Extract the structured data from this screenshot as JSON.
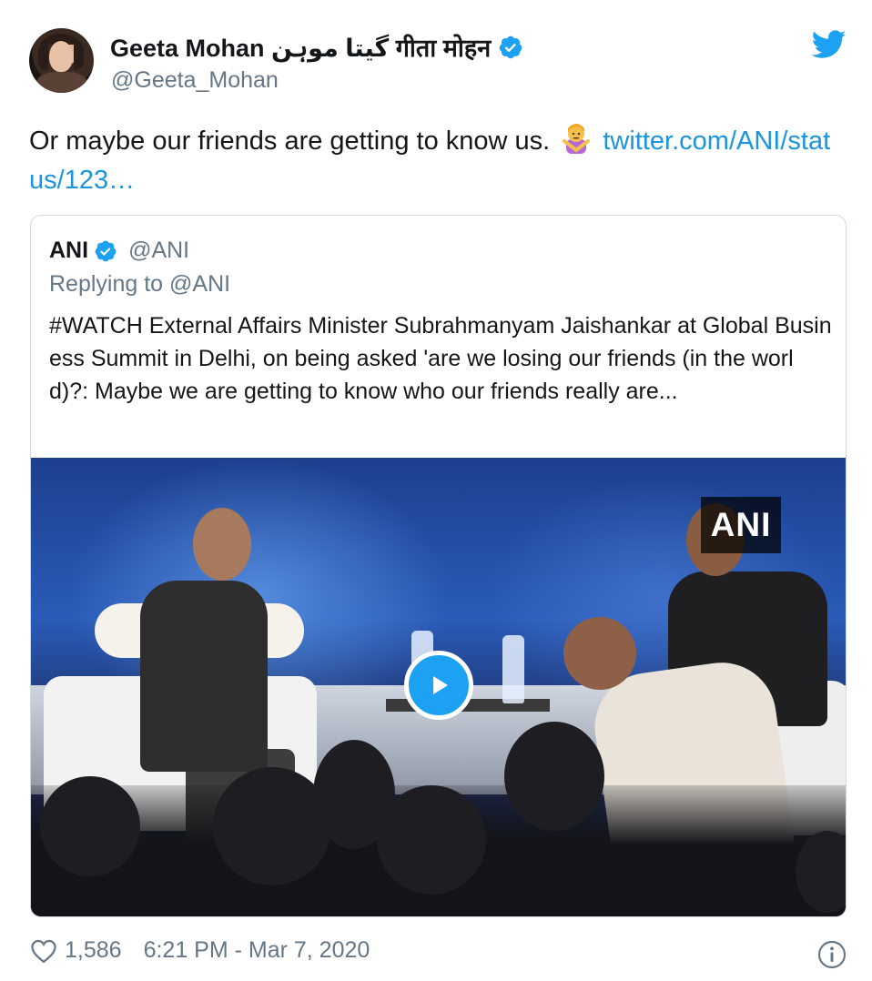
{
  "author": {
    "display_name": "Geeta Mohan گیتا موہن गीता मोहन",
    "handle": "@Geeta_Mohan",
    "verified": true
  },
  "tweet": {
    "text": "Or maybe our friends are getting to know us.",
    "emoji": "person-gesturing-no-emoji",
    "link": "twitter.com/ANI/status/123…"
  },
  "quoted_tweet": {
    "name": "ANI",
    "handle": "@ANI",
    "verified": true,
    "replying_to": "Replying to @ANI",
    "text": "#WATCH External Affairs Minister Subrahmanyam Jaishankar at Global Business Summit in Delhi, on being asked 'are we losing our friends (in the world)?: Maybe we are getting to know who our friends really are...",
    "video": {
      "watermark": "ANI",
      "play_icon": "play-icon"
    }
  },
  "footer": {
    "like_count": "1,586",
    "timestamp": "6:21 PM - Mar 7, 2020",
    "icons": [
      "heart-icon",
      "info-icon"
    ]
  },
  "colors": {
    "link": "#1b95e0",
    "verified": "#1da1f2",
    "secondary_text": "#657786"
  }
}
